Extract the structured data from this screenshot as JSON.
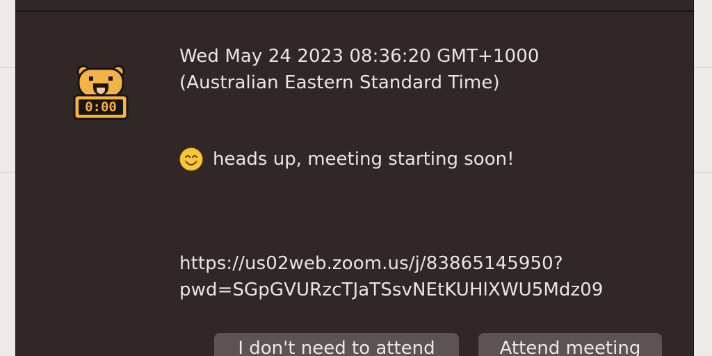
{
  "notification": {
    "date_line1": "Wed May 24 2023 08:36:20 GMT+1000",
    "date_line2": "(Australian Eastern Standard Time)",
    "message": "heads up, meeting starting soon!",
    "link_line1": "https://us02web.zoom.us/j/83865145950?",
    "link_line2": "pwd=SGpGVURzcTJaTSsvNEtKUHlXWU5Mdz09",
    "app_icon_clock_text": "0:00"
  },
  "buttons": {
    "decline_label": "I don't need to attend",
    "attend_label": "Attend meeting"
  },
  "colors": {
    "dialog_bg": "#302726",
    "text": "#e9e6e5",
    "button_bg": "#5c5352",
    "icon_orange": "#f2b24c"
  },
  "icons": {
    "app_icon": "bear-alarm-clock-icon",
    "emoji": "smiling-face-emoji-icon"
  }
}
